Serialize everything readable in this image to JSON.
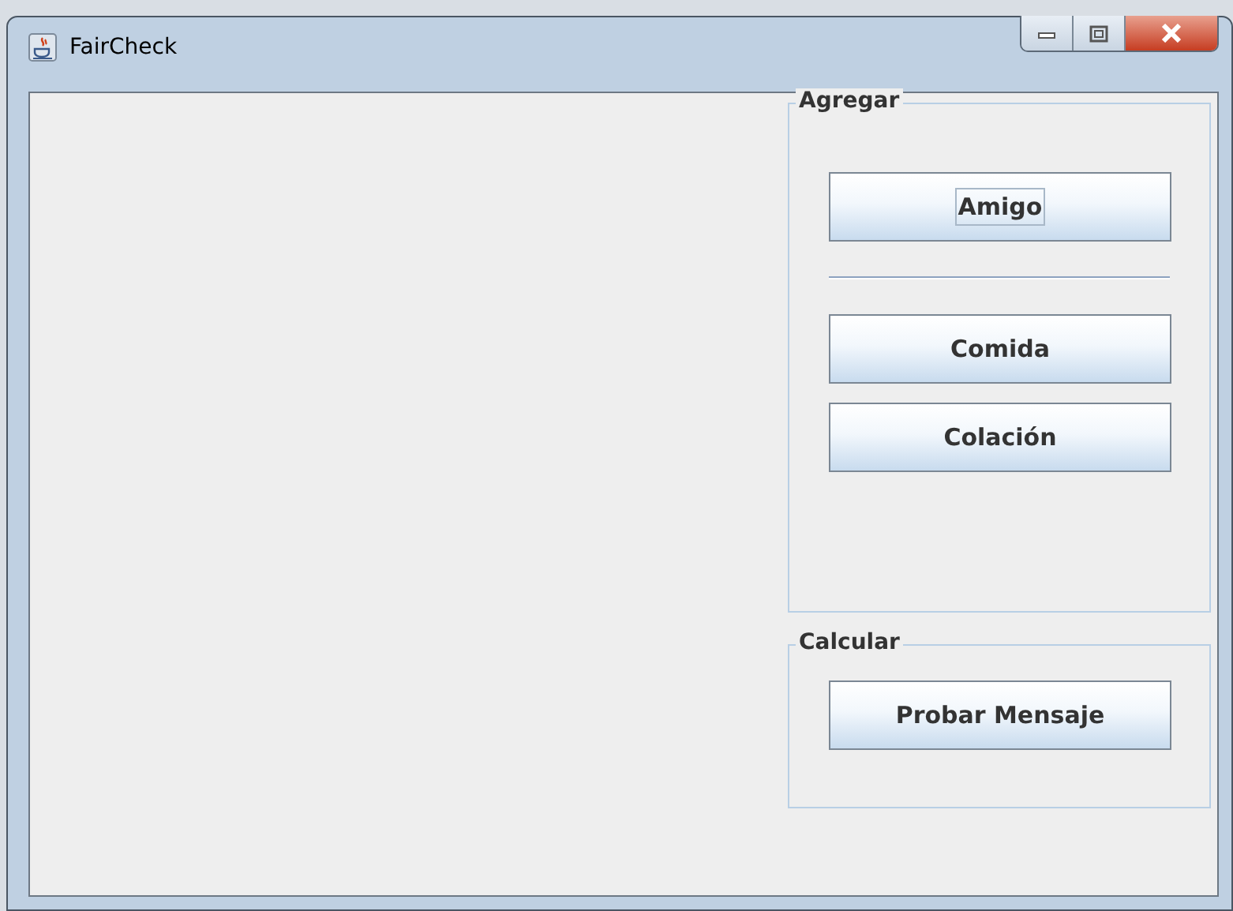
{
  "window": {
    "title": "FairCheck"
  },
  "groups": [
    {
      "title": "Agregar",
      "items": [
        {
          "kind": "button",
          "label": "Amigo",
          "focused": true
        },
        {
          "kind": "separator"
        },
        {
          "kind": "button",
          "label": "Comida",
          "focused": false
        },
        {
          "kind": "button",
          "label": "Colación",
          "focused": false
        }
      ]
    },
    {
      "title": "Calcular",
      "items": [
        {
          "kind": "button",
          "label": "Probar Mensaje",
          "focused": false
        }
      ]
    }
  ]
}
